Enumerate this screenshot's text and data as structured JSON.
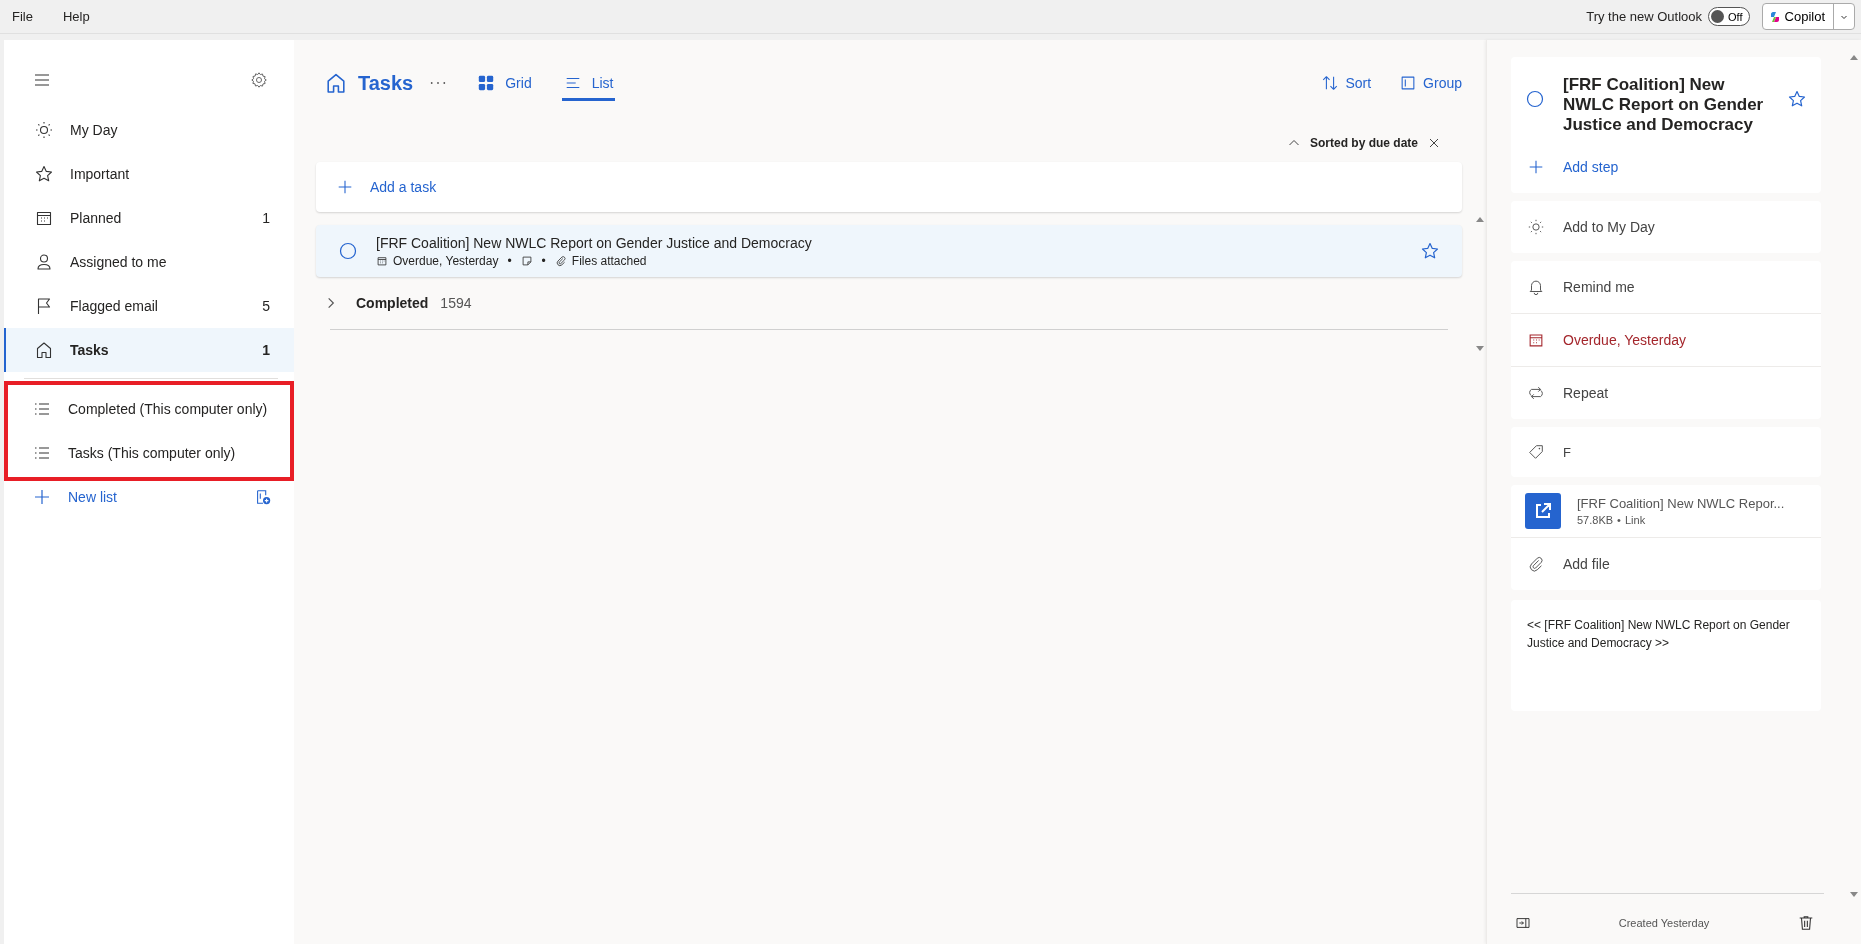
{
  "menu_bar": {
    "items": [
      "File",
      "Help"
    ],
    "try_new_outlook": "Try the new Outlook",
    "toggle": {
      "on": false,
      "label": "Off"
    },
    "copilot": "Copilot"
  },
  "sidebar": {
    "items": [
      {
        "label": "My Day",
        "selected": false
      },
      {
        "label": "Important",
        "selected": false
      },
      {
        "label": "Planned",
        "count": "1",
        "selected": false
      },
      {
        "label": "Assigned to me",
        "selected": false
      },
      {
        "label": "Flagged email",
        "count": "5",
        "selected": false
      },
      {
        "label": "Tasks",
        "count": "1",
        "selected": true
      }
    ],
    "lists": [
      {
        "label": "Completed (This computer only)",
        "selected": false
      },
      {
        "label": "Tasks (This computer only)",
        "selected": false
      }
    ],
    "new_list": "New list"
  },
  "main": {
    "title": "Tasks",
    "views": [
      {
        "label": "Grid",
        "selected": false
      },
      {
        "label": "List",
        "selected": true
      }
    ],
    "actions": [
      "Sort",
      "Group"
    ],
    "sort_indicator": "Sorted by due date",
    "add_task": {
      "placeholder": "Add a task"
    },
    "tasks": [
      {
        "title": "[FRF Coalition] New NWLC Report on Gender Justice and Democracy",
        "due": "Overdue, Yesterday",
        "separators": [
          "•",
          "•"
        ],
        "attachment": "Files attached",
        "completed": false,
        "important": false,
        "selected": true
      }
    ],
    "completed_group": {
      "label": "Completed",
      "count": "1594",
      "expanded": false
    }
  },
  "detail": {
    "title": "[FRF Coalition] New NWLC Report on Gender Justice and Democracy",
    "completed": false,
    "important": false,
    "add_step": "Add step",
    "add_to_my_day": "Add to My Day",
    "remind": "Remind me",
    "due": {
      "label": "Overdue, Yesterday",
      "overdue": true
    },
    "repeat": "Repeat",
    "category": "F",
    "file": {
      "name": "[FRF Coalition] New NWLC Repor...",
      "size": "57.8KB",
      "separator": "•",
      "type": "Link"
    },
    "add_file": "Add file",
    "note": "<< [FRF Coalition] New NWLC Report on Gender Justice and Democracy >>",
    "footer": "Created Yesterday"
  }
}
